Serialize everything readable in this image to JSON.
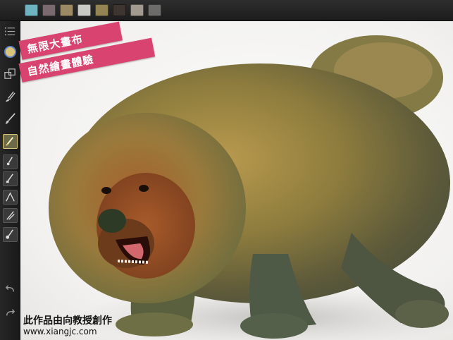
{
  "palette": {
    "swatches": [
      {
        "name": "teal",
        "color": "#6fb3c0"
      },
      {
        "name": "mauve",
        "color": "#7a6a70"
      },
      {
        "name": "tan",
        "color": "#9b8a63"
      },
      {
        "name": "light-gray",
        "color": "#c9c9c6"
      },
      {
        "name": "olive",
        "color": "#948353"
      },
      {
        "name": "dark-brown",
        "color": "#3e3430"
      },
      {
        "name": "beige",
        "color": "#a39a8f"
      },
      {
        "name": "gray",
        "color": "#6d6c6a"
      }
    ]
  },
  "toolbar": {
    "icons": [
      "menu-icon",
      "color-picker-icon",
      "layers-icon",
      "smudge-icon",
      "brush-icon",
      "brush-slot-active-icon",
      "brush-slot-1-icon",
      "brush-slot-2-icon",
      "brush-slot-3-icon",
      "brush-slot-4-icon",
      "brush-slot-5-icon",
      "undo-icon",
      "redo-icon"
    ]
  },
  "promo": {
    "line1": "無限大畫布",
    "line2": "自然繪畫體驗"
  },
  "credit": {
    "text": "此作品由向教授創作",
    "site": "www.xiangjc.com"
  },
  "accent": {
    "ribbon": "#d9436f",
    "selected": "#d9c27a"
  }
}
